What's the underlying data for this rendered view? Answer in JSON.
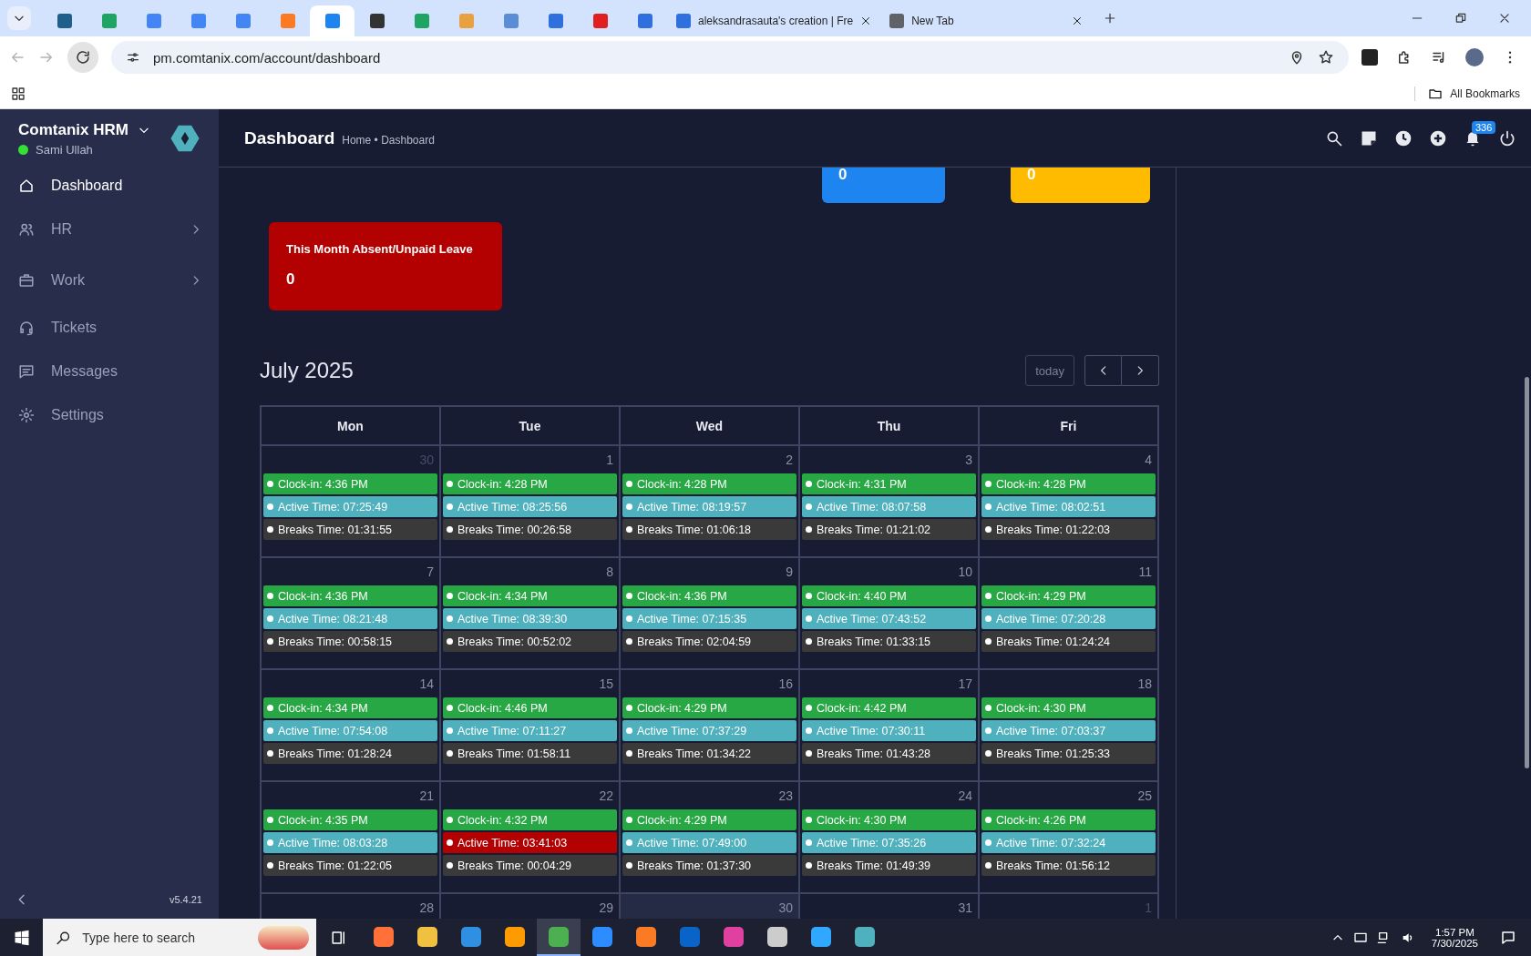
{
  "browser": {
    "tabs": [
      {
        "color": "#1f5f8b",
        "selected": false
      },
      {
        "color": "#1fa463",
        "selected": false
      },
      {
        "color": "#4285f4",
        "selected": false
      },
      {
        "color": "#4285f4",
        "selected": false
      },
      {
        "color": "#4285f4",
        "selected": false
      },
      {
        "color": "#fb7a24",
        "selected": false
      },
      {
        "color": "#1e84f0",
        "selected": true
      },
      {
        "color": "#333333",
        "selected": false
      },
      {
        "color": "#1fa463",
        "selected": false
      },
      {
        "color": "#e8a040",
        "selected": false
      },
      {
        "color": "#5b8dd6",
        "selected": false
      },
      {
        "color": "#2f6fde",
        "selected": false
      },
      {
        "color": "#e02020",
        "selected": false
      },
      {
        "color": "#2f6fde",
        "selected": false
      },
      {
        "color": "#2f6fde",
        "selected": false,
        "title": "aleksandrasauta's creation | Fre"
      },
      {
        "color": "#5f6368",
        "selected": false,
        "title": "New Tab"
      }
    ],
    "address": "pm.comtanix.com/account/dashboard",
    "bookmarks_label": "All Bookmarks"
  },
  "sidebar": {
    "brand": "Comtanix HRM",
    "user": "Sami Ullah",
    "online": true,
    "version": "v5.4.21",
    "items": [
      {
        "label": "Dashboard",
        "selected": true,
        "has_children": false
      },
      {
        "label": "HR",
        "selected": false,
        "has_children": true
      },
      {
        "label": "Work",
        "selected": false,
        "has_children": true
      },
      {
        "label": "Tickets",
        "selected": false,
        "has_children": false
      },
      {
        "label": "Messages",
        "selected": false,
        "has_children": false
      },
      {
        "label": "Settings",
        "selected": false,
        "has_children": false
      }
    ]
  },
  "header": {
    "title": "Dashboard",
    "breadcrumb": "Home • Dashboard",
    "notifications": "336"
  },
  "stat_cards": [
    {
      "value": "0",
      "color": "#1e84f0"
    },
    {
      "value": "0",
      "color": "#ffbb00"
    }
  ],
  "leave_card": {
    "title": "This Month Absent/Unpaid Leave",
    "value": "0",
    "color": "#b30000"
  },
  "calendar": {
    "title": "July 2025",
    "today_button": "today",
    "weekdays": [
      "Mon",
      "Tue",
      "Wed",
      "Thu",
      "Fri"
    ],
    "weeks": [
      {
        "days": [
          {
            "number": "30",
            "muted": true,
            "today": false,
            "entries": [
              {
                "kind": "clockin",
                "text": "Clock-in: 4:36 PM",
                "warning": false
              },
              {
                "kind": "active",
                "text": "Active Time: 07:25:49",
                "warning": false
              },
              {
                "kind": "breaks",
                "text": "Breaks Time: 01:31:55",
                "warning": false
              }
            ]
          },
          {
            "number": "1",
            "muted": false,
            "today": false,
            "entries": [
              {
                "kind": "clockin",
                "text": "Clock-in: 4:28 PM",
                "warning": false
              },
              {
                "kind": "active",
                "text": "Active Time: 08:25:56",
                "warning": false
              },
              {
                "kind": "breaks",
                "text": "Breaks Time: 00:26:58",
                "warning": false
              }
            ]
          },
          {
            "number": "2",
            "muted": false,
            "today": false,
            "entries": [
              {
                "kind": "clockin",
                "text": "Clock-in: 4:28 PM",
                "warning": false
              },
              {
                "kind": "active",
                "text": "Active Time: 08:19:57",
                "warning": false
              },
              {
                "kind": "breaks",
                "text": "Breaks Time: 01:06:18",
                "warning": false
              }
            ]
          },
          {
            "number": "3",
            "muted": false,
            "today": false,
            "entries": [
              {
                "kind": "clockin",
                "text": "Clock-in: 4:31 PM",
                "warning": false
              },
              {
                "kind": "active",
                "text": "Active Time: 08:07:58",
                "warning": false
              },
              {
                "kind": "breaks",
                "text": "Breaks Time: 01:21:02",
                "warning": false
              }
            ]
          },
          {
            "number": "4",
            "muted": false,
            "today": false,
            "entries": [
              {
                "kind": "clockin",
                "text": "Clock-in: 4:28 PM",
                "warning": false
              },
              {
                "kind": "active",
                "text": "Active Time: 08:02:51",
                "warning": false
              },
              {
                "kind": "breaks",
                "text": "Breaks Time: 01:22:03",
                "warning": false
              }
            ]
          }
        ]
      },
      {
        "days": [
          {
            "number": "7",
            "muted": false,
            "today": false,
            "entries": [
              {
                "kind": "clockin",
                "text": "Clock-in: 4:36 PM",
                "warning": false
              },
              {
                "kind": "active",
                "text": "Active Time: 08:21:48",
                "warning": false
              },
              {
                "kind": "breaks",
                "text": "Breaks Time: 00:58:15",
                "warning": false
              }
            ]
          },
          {
            "number": "8",
            "muted": false,
            "today": false,
            "entries": [
              {
                "kind": "clockin",
                "text": "Clock-in: 4:34 PM",
                "warning": false
              },
              {
                "kind": "active",
                "text": "Active Time: 08:39:30",
                "warning": false
              },
              {
                "kind": "breaks",
                "text": "Breaks Time: 00:52:02",
                "warning": false
              }
            ]
          },
          {
            "number": "9",
            "muted": false,
            "today": false,
            "entries": [
              {
                "kind": "clockin",
                "text": "Clock-in: 4:36 PM",
                "warning": false
              },
              {
                "kind": "active",
                "text": "Active Time: 07:15:35",
                "warning": false
              },
              {
                "kind": "breaks",
                "text": "Breaks Time: 02:04:59",
                "warning": false
              }
            ]
          },
          {
            "number": "10",
            "muted": false,
            "today": false,
            "entries": [
              {
                "kind": "clockin",
                "text": "Clock-in: 4:40 PM",
                "warning": false
              },
              {
                "kind": "active",
                "text": "Active Time: 07:43:52",
                "warning": false
              },
              {
                "kind": "breaks",
                "text": "Breaks Time: 01:33:15",
                "warning": false
              }
            ]
          },
          {
            "number": "11",
            "muted": false,
            "today": false,
            "entries": [
              {
                "kind": "clockin",
                "text": "Clock-in: 4:29 PM",
                "warning": false
              },
              {
                "kind": "active",
                "text": "Active Time: 07:20:28",
                "warning": false
              },
              {
                "kind": "breaks",
                "text": "Breaks Time: 01:24:24",
                "warning": false
              }
            ]
          }
        ]
      },
      {
        "days": [
          {
            "number": "14",
            "muted": false,
            "today": false,
            "entries": [
              {
                "kind": "clockin",
                "text": "Clock-in: 4:34 PM",
                "warning": false
              },
              {
                "kind": "active",
                "text": "Active Time: 07:54:08",
                "warning": false
              },
              {
                "kind": "breaks",
                "text": "Breaks Time: 01:28:24",
                "warning": false
              }
            ]
          },
          {
            "number": "15",
            "muted": false,
            "today": false,
            "entries": [
              {
                "kind": "clockin",
                "text": "Clock-in: 4:46 PM",
                "warning": false
              },
              {
                "kind": "active",
                "text": "Active Time: 07:11:27",
                "warning": false
              },
              {
                "kind": "breaks",
                "text": "Breaks Time: 01:58:11",
                "warning": false
              }
            ]
          },
          {
            "number": "16",
            "muted": false,
            "today": false,
            "entries": [
              {
                "kind": "clockin",
                "text": "Clock-in: 4:29 PM",
                "warning": false
              },
              {
                "kind": "active",
                "text": "Active Time: 07:37:29",
                "warning": false
              },
              {
                "kind": "breaks",
                "text": "Breaks Time: 01:34:22",
                "warning": false
              }
            ]
          },
          {
            "number": "17",
            "muted": false,
            "today": false,
            "entries": [
              {
                "kind": "clockin",
                "text": "Clock-in: 4:42 PM",
                "warning": false
              },
              {
                "kind": "active",
                "text": "Active Time: 07:30:11",
                "warning": false
              },
              {
                "kind": "breaks",
                "text": "Breaks Time: 01:43:28",
                "warning": false
              }
            ]
          },
          {
            "number": "18",
            "muted": false,
            "today": false,
            "entries": [
              {
                "kind": "clockin",
                "text": "Clock-in: 4:30 PM",
                "warning": false
              },
              {
                "kind": "active",
                "text": "Active Time: 07:03:37",
                "warning": false
              },
              {
                "kind": "breaks",
                "text": "Breaks Time: 01:25:33",
                "warning": false
              }
            ]
          }
        ]
      },
      {
        "days": [
          {
            "number": "21",
            "muted": false,
            "today": false,
            "entries": [
              {
                "kind": "clockin",
                "text": "Clock-in: 4:35 PM",
                "warning": false
              },
              {
                "kind": "active",
                "text": "Active Time: 08:03:28",
                "warning": false
              },
              {
                "kind": "breaks",
                "text": "Breaks Time: 01:22:05",
                "warning": false
              }
            ]
          },
          {
            "number": "22",
            "muted": false,
            "today": false,
            "entries": [
              {
                "kind": "clockin",
                "text": "Clock-in: 4:32 PM",
                "warning": false
              },
              {
                "kind": "active",
                "text": "Active Time: 03:41:03",
                "warning": true
              },
              {
                "kind": "breaks",
                "text": "Breaks Time: 00:04:29",
                "warning": false
              }
            ]
          },
          {
            "number": "23",
            "muted": false,
            "today": false,
            "entries": [
              {
                "kind": "clockin",
                "text": "Clock-in: 4:29 PM",
                "warning": false
              },
              {
                "kind": "active",
                "text": "Active Time: 07:49:00",
                "warning": false
              },
              {
                "kind": "breaks",
                "text": "Breaks Time: 01:37:30",
                "warning": false
              }
            ]
          },
          {
            "number": "24",
            "muted": false,
            "today": false,
            "entries": [
              {
                "kind": "clockin",
                "text": "Clock-in: 4:30 PM",
                "warning": false
              },
              {
                "kind": "active",
                "text": "Active Time: 07:35:26",
                "warning": false
              },
              {
                "kind": "breaks",
                "text": "Breaks Time: 01:49:39",
                "warning": false
              }
            ]
          },
          {
            "number": "25",
            "muted": false,
            "today": false,
            "entries": [
              {
                "kind": "clockin",
                "text": "Clock-in: 4:26 PM",
                "warning": false
              },
              {
                "kind": "active",
                "text": "Active Time: 07:32:24",
                "warning": false
              },
              {
                "kind": "breaks",
                "text": "Breaks Time: 01:56:12",
                "warning": false
              }
            ]
          }
        ]
      },
      {
        "days": [
          {
            "number": "28",
            "muted": false,
            "today": false
          },
          {
            "number": "29",
            "muted": false,
            "today": false
          },
          {
            "number": "30",
            "muted": false,
            "today": true
          },
          {
            "number": "31",
            "muted": false,
            "today": false
          },
          {
            "number": "1",
            "muted": true,
            "today": false
          }
        ]
      }
    ]
  },
  "taskbar": {
    "search_placeholder": "Type here to search",
    "apps": [
      {
        "color": "#ff7139",
        "selected": false
      },
      {
        "color": "#f0c040",
        "selected": false
      },
      {
        "color": "#2f8fe0",
        "selected": false
      },
      {
        "color": "#ff9a00",
        "selected": false
      },
      {
        "color": "#4caf50",
        "selected": true
      },
      {
        "color": "#2d8cff",
        "selected": false
      },
      {
        "color": "#fb7a24",
        "selected": false
      },
      {
        "color": "#0a64c8",
        "selected": false
      },
      {
        "color": "#e040a0",
        "selected": false
      },
      {
        "color": "#cccccc",
        "selected": false
      },
      {
        "color": "#31a8ff",
        "selected": false
      },
      {
        "color": "#4fb1bd",
        "selected": false
      }
    ],
    "time": "1:57 PM",
    "date": "7/30/2025"
  }
}
